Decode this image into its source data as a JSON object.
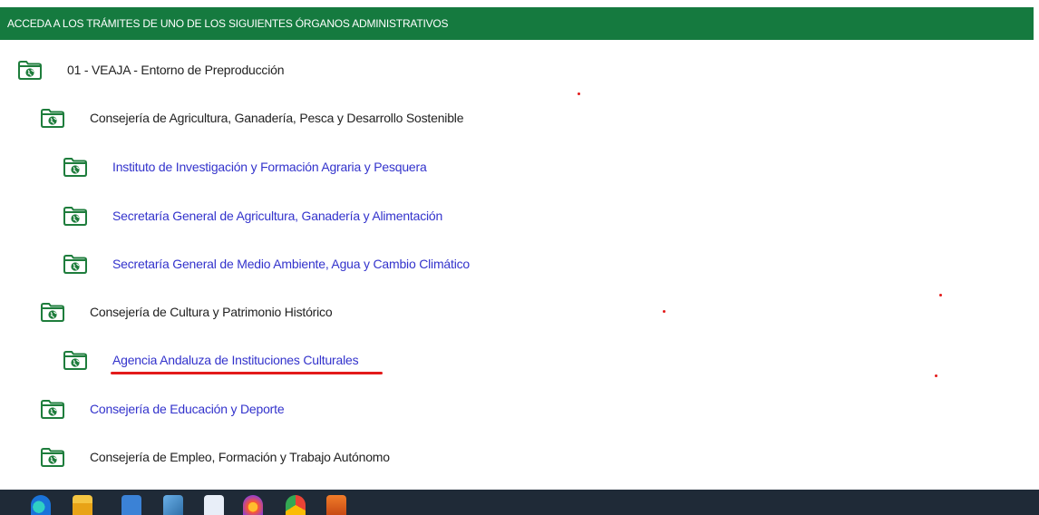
{
  "header": {
    "title": "ACCEDA A LOS TRÁMITES DE UNO DE LOS SIGUIENTES ÓRGANOS ADMINISTRATIVOS"
  },
  "tree": [
    {
      "label": "01 - VEAJA - Entorno de Preproducción",
      "level": 0,
      "link": false
    },
    {
      "label": "Consejería de Agricultura, Ganadería, Pesca y Desarrollo Sostenible",
      "level": 1,
      "link": false
    },
    {
      "label": "Instituto de Investigación y Formación Agraria y Pesquera",
      "level": 2,
      "link": true
    },
    {
      "label": "Secretaría General de Agricultura, Ganadería y Alimentación",
      "level": 2,
      "link": true
    },
    {
      "label": "Secretaría General de Medio Ambiente, Agua y Cambio Climático",
      "level": 2,
      "link": true
    },
    {
      "label": "Consejería de Cultura y Patrimonio Histórico",
      "level": 1,
      "link": false
    },
    {
      "label": "Agencia Andaluza de Instituciones Culturales",
      "level": 2,
      "link": true
    },
    {
      "label": "Consejería de Educación y Deporte",
      "level": 1,
      "link": true
    },
    {
      "label": "Consejería de Empleo, Formación y Trabajo Autónomo",
      "level": 1,
      "link": false
    }
  ],
  "colors": {
    "header_bg": "#157a3f",
    "folder": "#1e7d3c",
    "link": "#3333cc",
    "annotation": "#e31b1b"
  },
  "taskbar": {
    "icons": [
      "edge-icon",
      "file-explorer-icon",
      "store-icon",
      "image-viewer-icon",
      "word-icon",
      "firefox-icon",
      "chrome-icon",
      "app-icon"
    ]
  }
}
